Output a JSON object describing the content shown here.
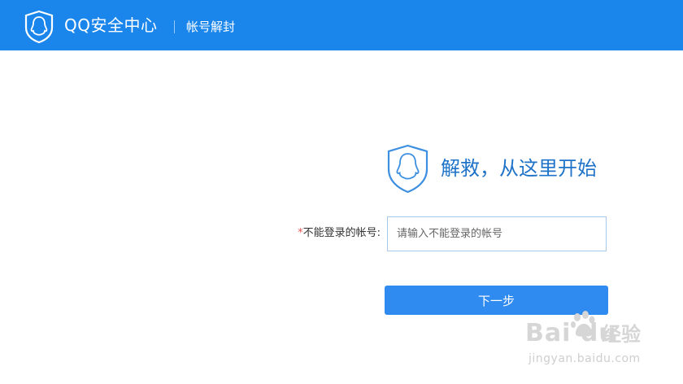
{
  "header": {
    "brand_title": "QQ安全中心",
    "section_title": "帐号解封",
    "logo_icon": "qq-shield-icon"
  },
  "main": {
    "heading": "解救，从这里开始",
    "logo_icon": "qq-shield-icon",
    "field": {
      "required_mark": "*",
      "label": "不能登录的帐号:",
      "value": "",
      "placeholder": "请输入不能登录的帐号"
    },
    "next_button_label": "下一步"
  },
  "watermark": {
    "logo_text": "Bai du",
    "text": "经验",
    "url": "jingyan.baidu.com"
  },
  "colors": {
    "header_bg": "#1a86ec",
    "heading": "#1e73c9",
    "button_bg": "#2f8bf0",
    "input_border": "#a9c9ec",
    "required": "#e25555"
  }
}
